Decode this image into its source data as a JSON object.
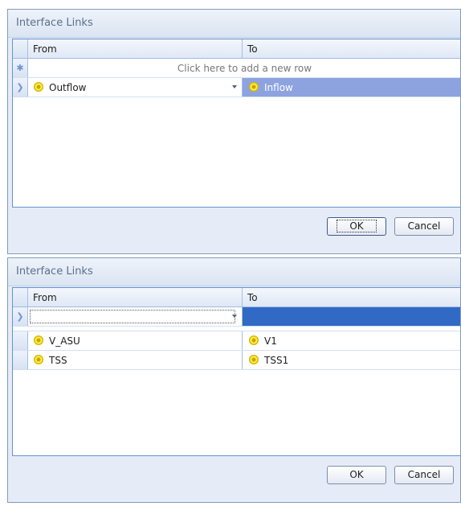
{
  "dialogs": [
    {
      "title": "Interface Links",
      "columns": {
        "from": "From",
        "to": "To"
      },
      "new_row_text": "Click here to add a new row",
      "active_row": {
        "from": "Outflow",
        "to": "Inflow"
      },
      "buttons": {
        "ok": "OK",
        "cancel": "Cancel"
      }
    },
    {
      "title": "Interface Links",
      "columns": {
        "from": "From",
        "to": "To"
      },
      "active_row": {
        "from": "",
        "to": ""
      },
      "rows": [
        {
          "from": "V_ASU",
          "to": "V1"
        },
        {
          "from": "TSS",
          "to": "TSS1"
        }
      ],
      "buttons": {
        "ok": "OK",
        "cancel": "Cancel"
      }
    }
  ],
  "icons": {
    "row_pointer": "chevron-right-icon",
    "new_row_marker": "asterisk-icon",
    "link_node": "yellow-node-icon",
    "dropdown": "dropdown-arrow-icon"
  },
  "colors": {
    "selected_cell": "#8da3e0",
    "selected_cell_dark": "#316ac5",
    "grid_border": "#6593cf",
    "dialog_bg": "#e5ecf7"
  }
}
